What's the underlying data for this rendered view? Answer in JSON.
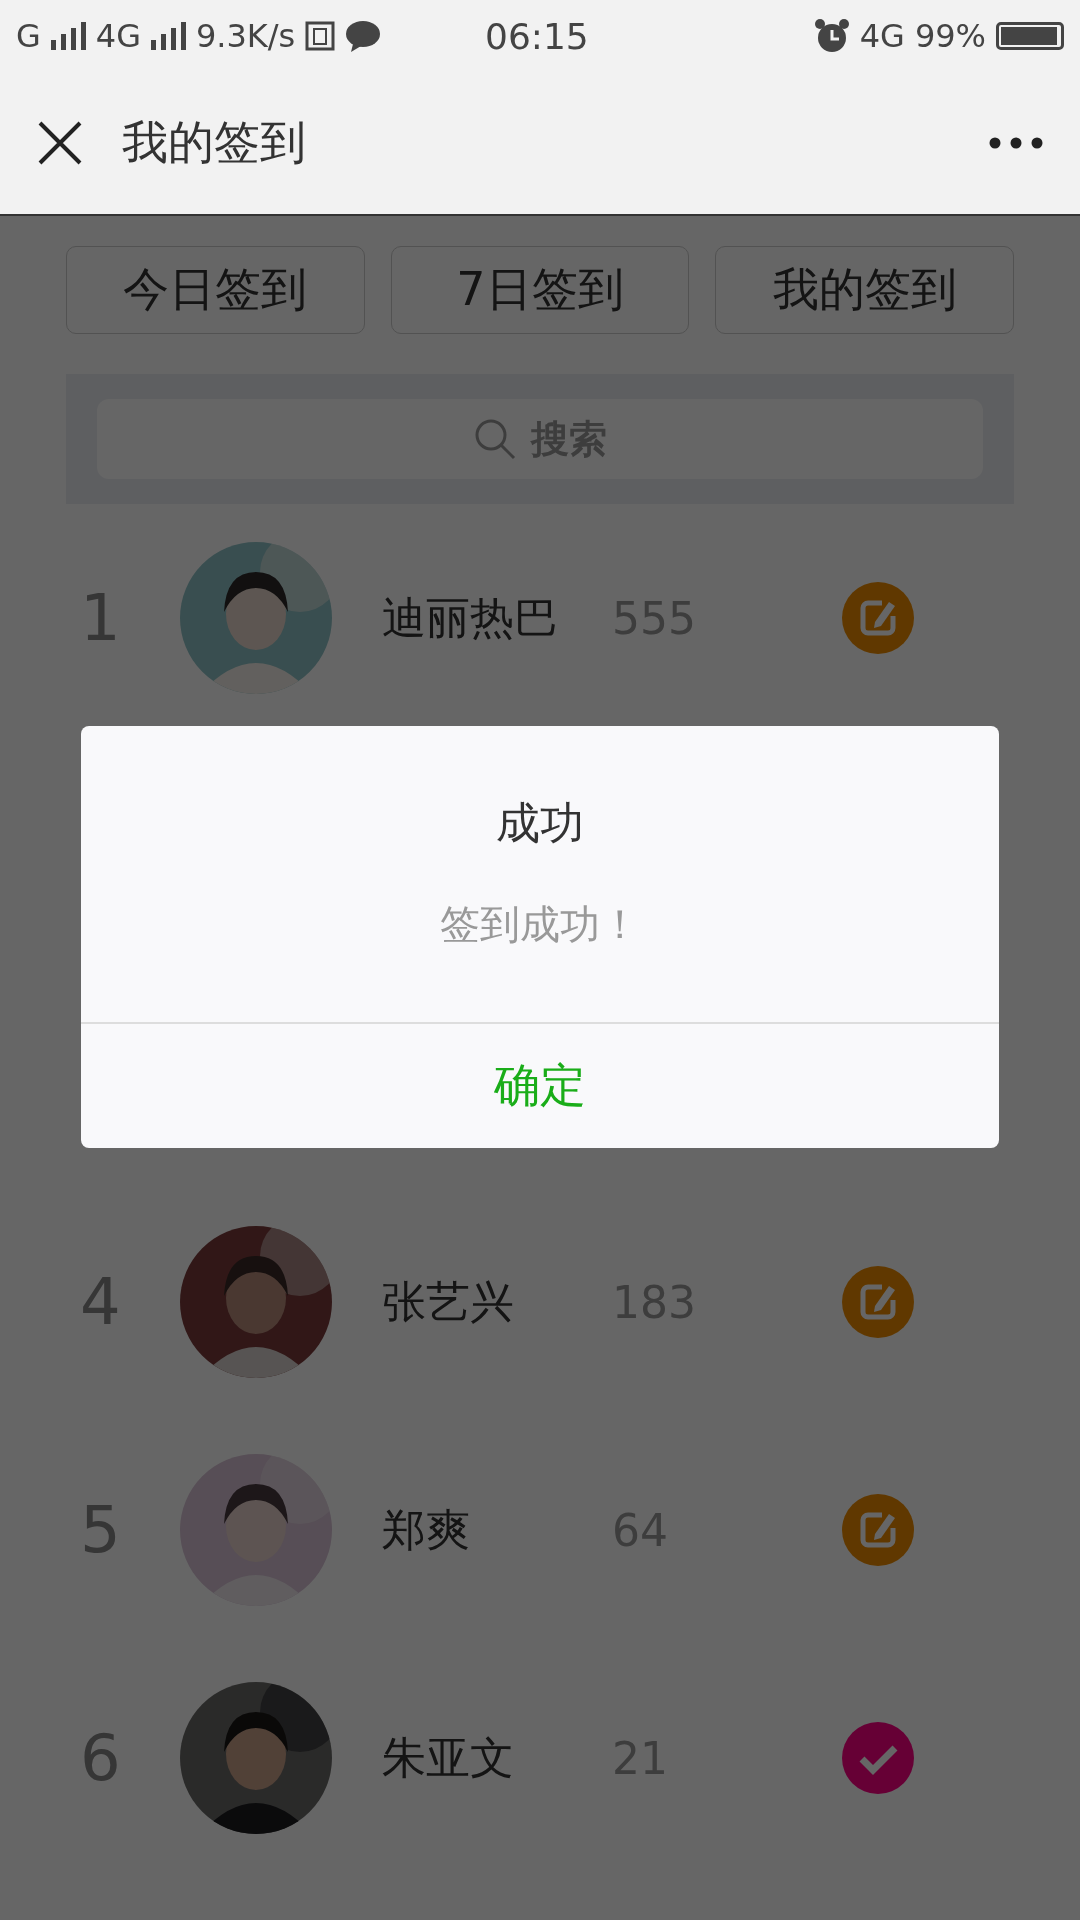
{
  "status_bar": {
    "left": [
      "G",
      "4G",
      "9.3K/s"
    ],
    "time": "06:15",
    "network": "4G",
    "battery": "99%"
  },
  "header": {
    "title": "我的签到"
  },
  "tabs": [
    {
      "label": "今日签到"
    },
    {
      "label": "7日签到"
    },
    {
      "label": "我的签到"
    }
  ],
  "search": {
    "placeholder": "搜索"
  },
  "rows": [
    {
      "rank": "1",
      "name": "迪丽热巴",
      "count": "555",
      "kind": "checkin"
    },
    {
      "rank": "4",
      "name": "张艺兴",
      "count": "183",
      "kind": "checkin"
    },
    {
      "rank": "5",
      "name": "郑爽",
      "count": "64",
      "kind": "checkin"
    },
    {
      "rank": "6",
      "name": "朱亚文",
      "count": "21",
      "kind": "done"
    }
  ],
  "dialog": {
    "title": "成功",
    "message": "签到成功！",
    "button": "确定"
  }
}
